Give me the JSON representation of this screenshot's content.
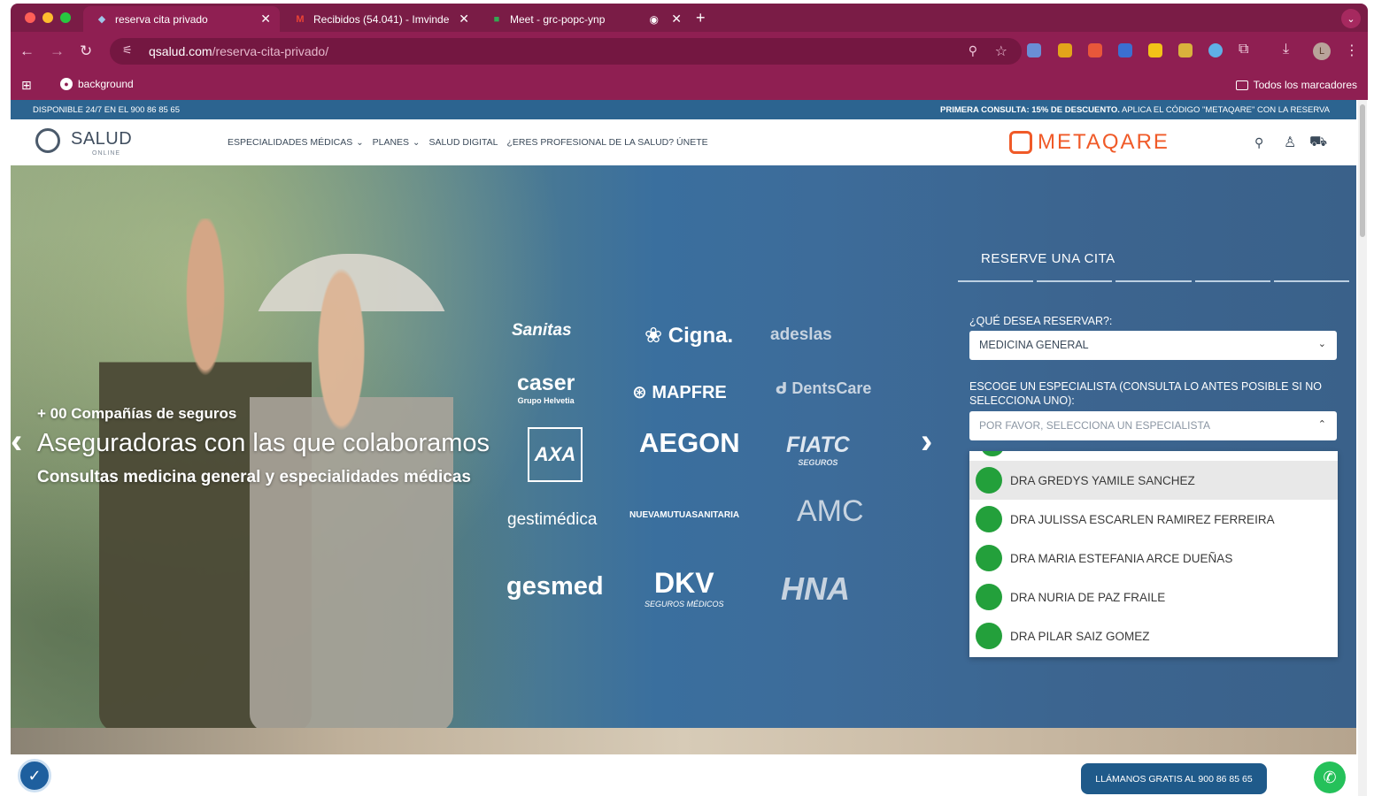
{
  "browser": {
    "tabs": [
      {
        "title": "reserva cita privado"
      },
      {
        "title": "Recibidos (54.041) - Imvinde"
      },
      {
        "title": "Meet - grc-popc-ynp"
      }
    ],
    "url_host": "qsalud.com",
    "url_path": "/reserva-cita-privado/",
    "bookmarks": {
      "item": "background",
      "all": "Todos los marcadores"
    }
  },
  "site": {
    "top_left": "DISPONIBLE 24/7 EN EL 900 86 85 65",
    "top_right_bold": "PRIMERA CONSULTA: 15% DE DESCUENTO.",
    "top_right_rest": "APLICA EL CÓDIGO \"METAQARE\" CON LA RESERVA",
    "logo_main": "SALUD",
    "logo_sub": "ONLINE",
    "nav": [
      "ESPECIALIDADES MÉDICAS",
      "PLANES",
      "SALUD DIGITAL",
      "¿ERES PROFESIONAL DE LA SALUD? ÚNETE"
    ],
    "partner_logo": "METAQARE"
  },
  "hero": {
    "kicker": "+ 00 Compañías de seguros",
    "title": "Aseguradoras con las que colaboramos",
    "subtitle": "Consultas medicina general y especialidades médicas",
    "insurers": {
      "sanitas": "Sanitas",
      "cigna": "Cigna.",
      "adeslas": "adeslas",
      "caser": "caser",
      "caser_sub": "Grupo Helvetia",
      "mapfre": "MAPFRE",
      "dentscare": "DentsCare",
      "axa": "AXA",
      "aegon": "AEGON",
      "fiatc": "FIATC",
      "fiatc_sub": "SEGUROS",
      "gestimedica": "gestimédica",
      "nuevamutua": "NUEVAMUTUASANITARIA",
      "amc": "AMC",
      "gesmed": "gesmed",
      "dkv": "DKV",
      "dkv_sub": "SEGUROS MÉDICOS",
      "hna": "HNA"
    }
  },
  "booking": {
    "title": "RESERVE UNA CITA",
    "q1_label": "¿QUÉ DESEA RESERVAR?:",
    "q1_value": "MEDICINA GENERAL",
    "q2_label": "ESCOGE UN ESPECIALISTA (CONSULTA LO ANTES POSIBLE SI NO SELECCIONA UNO):",
    "q2_placeholder": "POR FAVOR, SELECCIONA UN ESPECIALISTA",
    "specialists": [
      "DRA GREDYS YAMILE SANCHEZ",
      "DRA JULISSA ESCARLEN RAMIREZ FERREIRA",
      "DRA MARIA ESTEFANIA ARCE DUEÑAS",
      "DRA NURIA DE PAZ FRAILE",
      "DRA PILAR SAIZ GOMEZ"
    ]
  },
  "footer": {
    "call": "LLÁMANOS GRATIS AL 900 86 85 65"
  },
  "colors": {
    "chrome": "#8f1f52",
    "site_blue": "#2c6490",
    "accent_orange": "#f05a28",
    "avatar_green": "#23a03b"
  }
}
